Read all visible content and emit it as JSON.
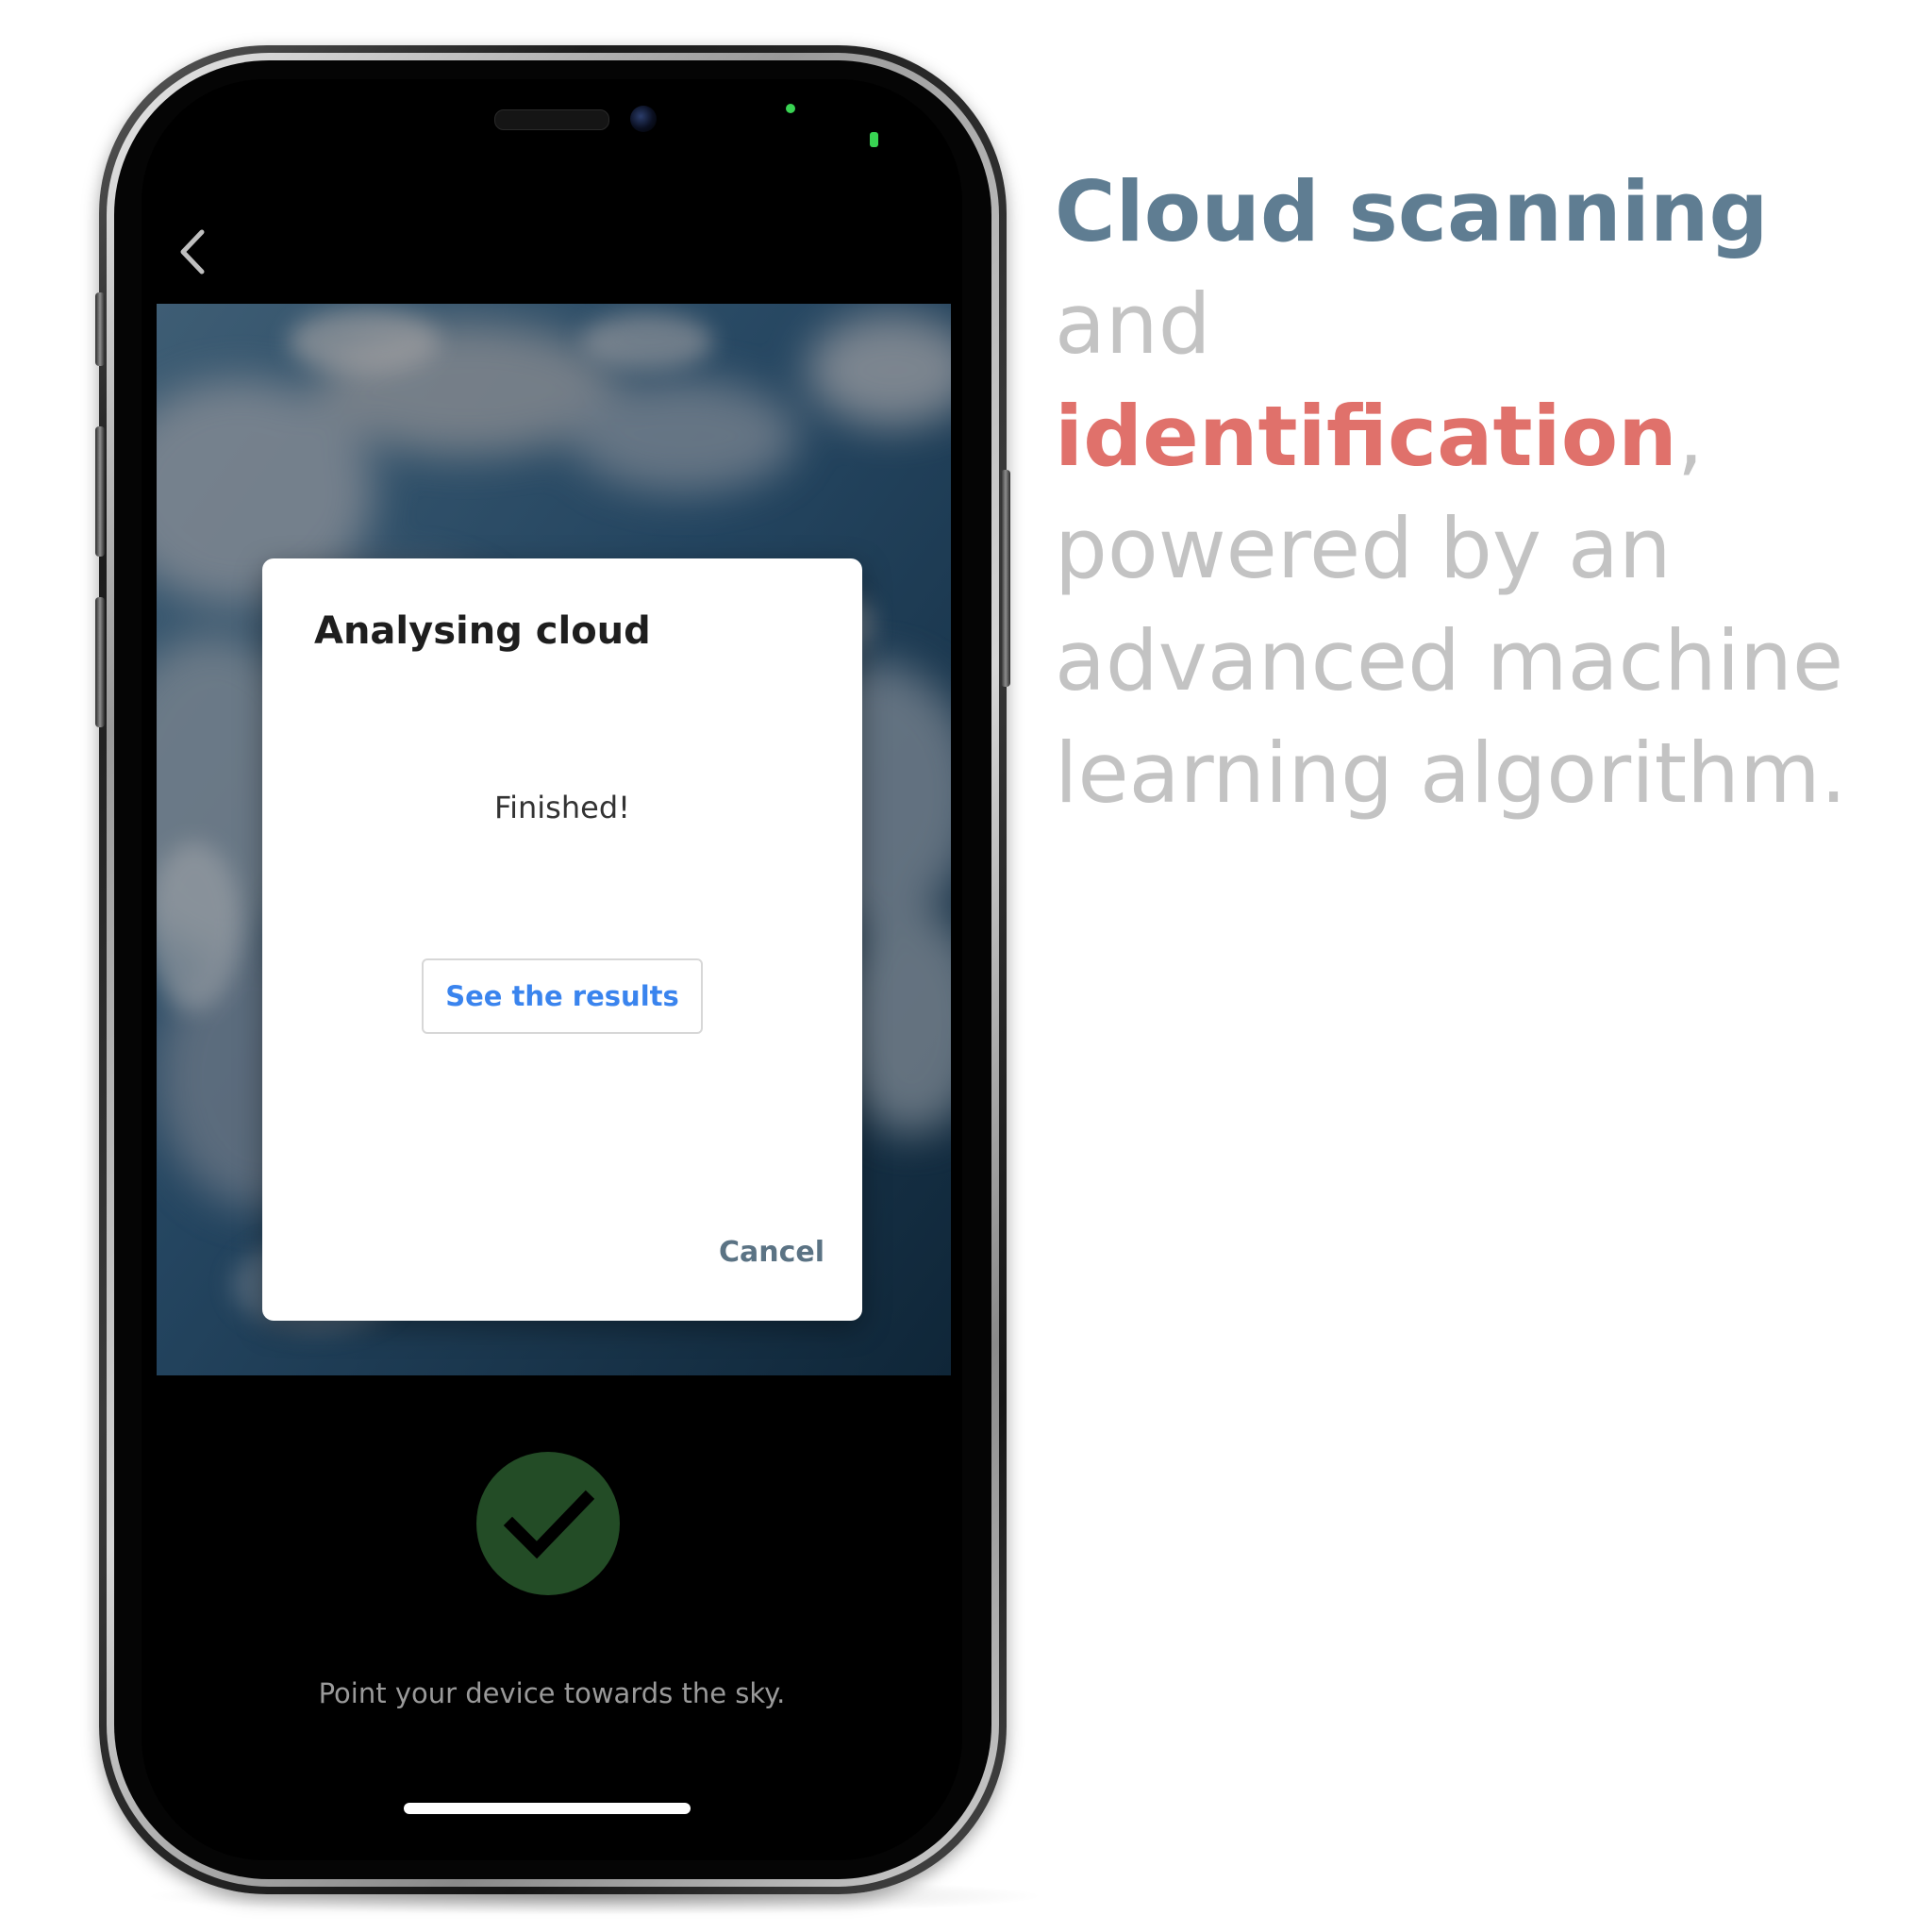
{
  "dialog": {
    "title": "Analysing cloud",
    "status": "Finished!",
    "results_button": "See the results",
    "cancel_button": "Cancel"
  },
  "camera": {
    "hint": "Point your device towards the sky."
  },
  "headline": {
    "part1": "Cloud scanning",
    "part2": " and ",
    "part3": "identification",
    "part4": ",",
    "part5": "powered by an advanced machine learning algorithm."
  },
  "colors": {
    "accent_blue": "#5f7d92",
    "accent_red": "#e0716b",
    "success_green": "#234c26",
    "link_blue": "#3a84ee"
  },
  "icons": {
    "back": "chevron-left-icon",
    "capture": "checkmark-icon"
  }
}
